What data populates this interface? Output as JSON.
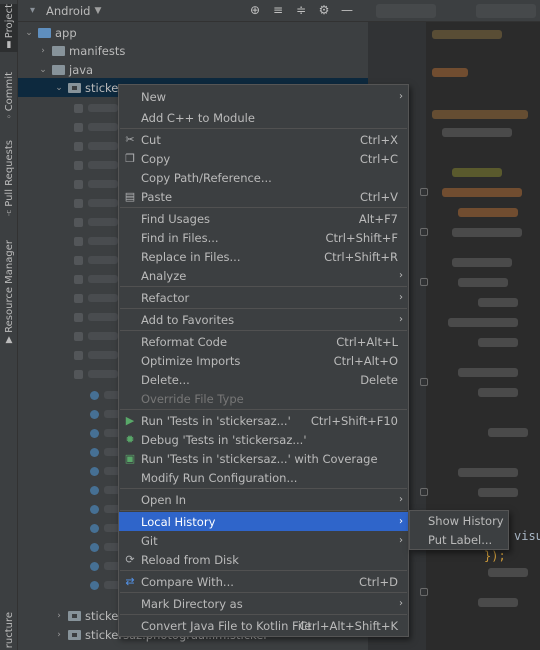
{
  "side_tabs": {
    "project": "Project",
    "commit": "Commit",
    "pull_requests": "Pull Requests",
    "resource_manager": "Resource Manager",
    "structure": "ructure"
  },
  "panel": {
    "title": "Android",
    "tools": [
      "⊕",
      "≡",
      "≑",
      "⚙",
      "—"
    ]
  },
  "tree": {
    "app": "app",
    "manifests": "manifests",
    "java": "java",
    "selected_pkg": "sticke",
    "bottom_pkg1": "sticke",
    "bottom_pkg2": "stickersaz.photograaf.im.sticker"
  },
  "menu": {
    "new": "New",
    "add_cpp": "Add C++ to Module",
    "cut": "Cut",
    "cut_sc": "Ctrl+X",
    "copy": "Copy",
    "copy_sc": "Ctrl+C",
    "copy_path": "Copy Path/Reference...",
    "paste": "Paste",
    "paste_sc": "Ctrl+V",
    "find_usages": "Find Usages",
    "find_usages_sc": "Alt+F7",
    "find_in_files": "Find in Files...",
    "find_in_files_sc": "Ctrl+Shift+F",
    "replace_in_files": "Replace in Files...",
    "replace_in_files_sc": "Ctrl+Shift+R",
    "analyze": "Analyze",
    "refactor": "Refactor",
    "add_favorites": "Add to Favorites",
    "reformat": "Reformat Code",
    "reformat_sc": "Ctrl+Alt+L",
    "optimize": "Optimize Imports",
    "optimize_sc": "Ctrl+Alt+O",
    "delete": "Delete...",
    "delete_sc": "Delete",
    "override_file_type": "Override File Type",
    "run_tests": "Run 'Tests in 'stickersaz...'",
    "run_tests_sc": "Ctrl+Shift+F10",
    "debug_tests": "Debug 'Tests in 'stickersaz...'",
    "run_coverage": "Run 'Tests in 'stickersaz...' with Coverage",
    "modify_run": "Modify Run Configuration...",
    "open_in": "Open In",
    "local_history": "Local History",
    "git": "Git",
    "reload": "Reload from Disk",
    "compare_with": "Compare With...",
    "compare_with_sc": "Ctrl+D",
    "mark_dir": "Mark Directory as",
    "convert_kotlin": "Convert Java File to Kotlin File",
    "convert_kotlin_sc": "Ctrl+Alt+Shift+K"
  },
  "submenu": {
    "show_history": "Show History",
    "put_label": "Put Label..."
  },
  "editor": {
    "visible_text": "visu",
    "brace": "});"
  },
  "colors": {
    "highlight": "#2f65ca",
    "menu_bg": "#3c3f41",
    "editor_bg": "#2b2b2b"
  }
}
